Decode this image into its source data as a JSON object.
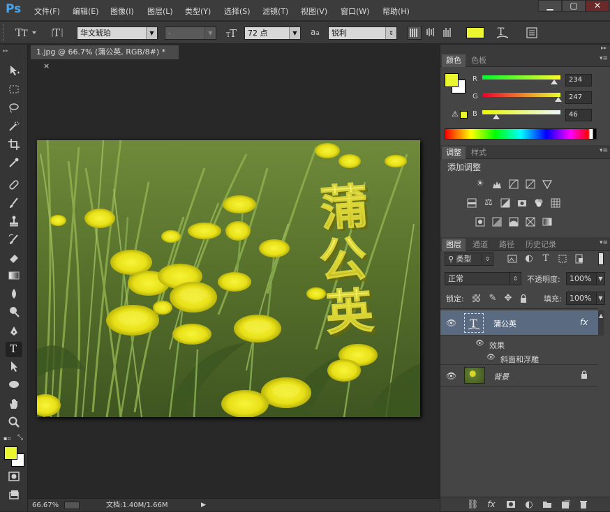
{
  "app": {
    "logo": "Ps"
  },
  "menubar": {
    "items": [
      "文件(F)",
      "编辑(E)",
      "图像(I)",
      "图层(L)",
      "类型(Y)",
      "选择(S)",
      "滤镜(T)",
      "视图(V)",
      "窗口(W)",
      "帮助(H)"
    ],
    "window_buttons": [
      "▁",
      "▢",
      "✕"
    ]
  },
  "options_bar": {
    "font_family": "华文琥珀",
    "font_style": "-",
    "font_size": "72 点",
    "anti_alias_icon_text": "a",
    "anti_alias": "锐利",
    "text_color": "#eaf72e"
  },
  "document": {
    "tab_title": "1.jpg @ 66.7% (蒲公英, RGB/8#) *",
    "close": "×",
    "text_layer_content": [
      "蒲",
      "公",
      "英"
    ]
  },
  "status_bar": {
    "zoom": "66.67%",
    "doc_info": "文档:1.40M/1.66M"
  },
  "toolbox": {
    "foreground_color": "#eaf72e",
    "background_color": "#ffffff"
  },
  "color_panel": {
    "tabs": [
      "颜色",
      "色板"
    ],
    "r_label": "R",
    "g_label": "G",
    "b_label": "B",
    "r": "234",
    "g": "247",
    "b": "46",
    "r_level": 0.918,
    "g_level": 0.969,
    "b_level": 0.18,
    "swatch": "#eaf72e"
  },
  "adjustments_panel": {
    "tabs": [
      "调整",
      "样式"
    ],
    "title": "添加调整"
  },
  "layers_panel": {
    "tabs": [
      "图层",
      "通道",
      "路径",
      "历史记录"
    ],
    "filter_kind": "类型",
    "blend_mode": "正常",
    "opacity_label": "不透明度:",
    "opacity": "100%",
    "lock_label": "锁定:",
    "fill_label": "填充:",
    "fill": "100%",
    "layers": [
      {
        "name": "蒲公英",
        "fx": "fx",
        "effects_label": "效果",
        "effect": "斜面和浮雕"
      },
      {
        "name": "背景"
      }
    ]
  }
}
